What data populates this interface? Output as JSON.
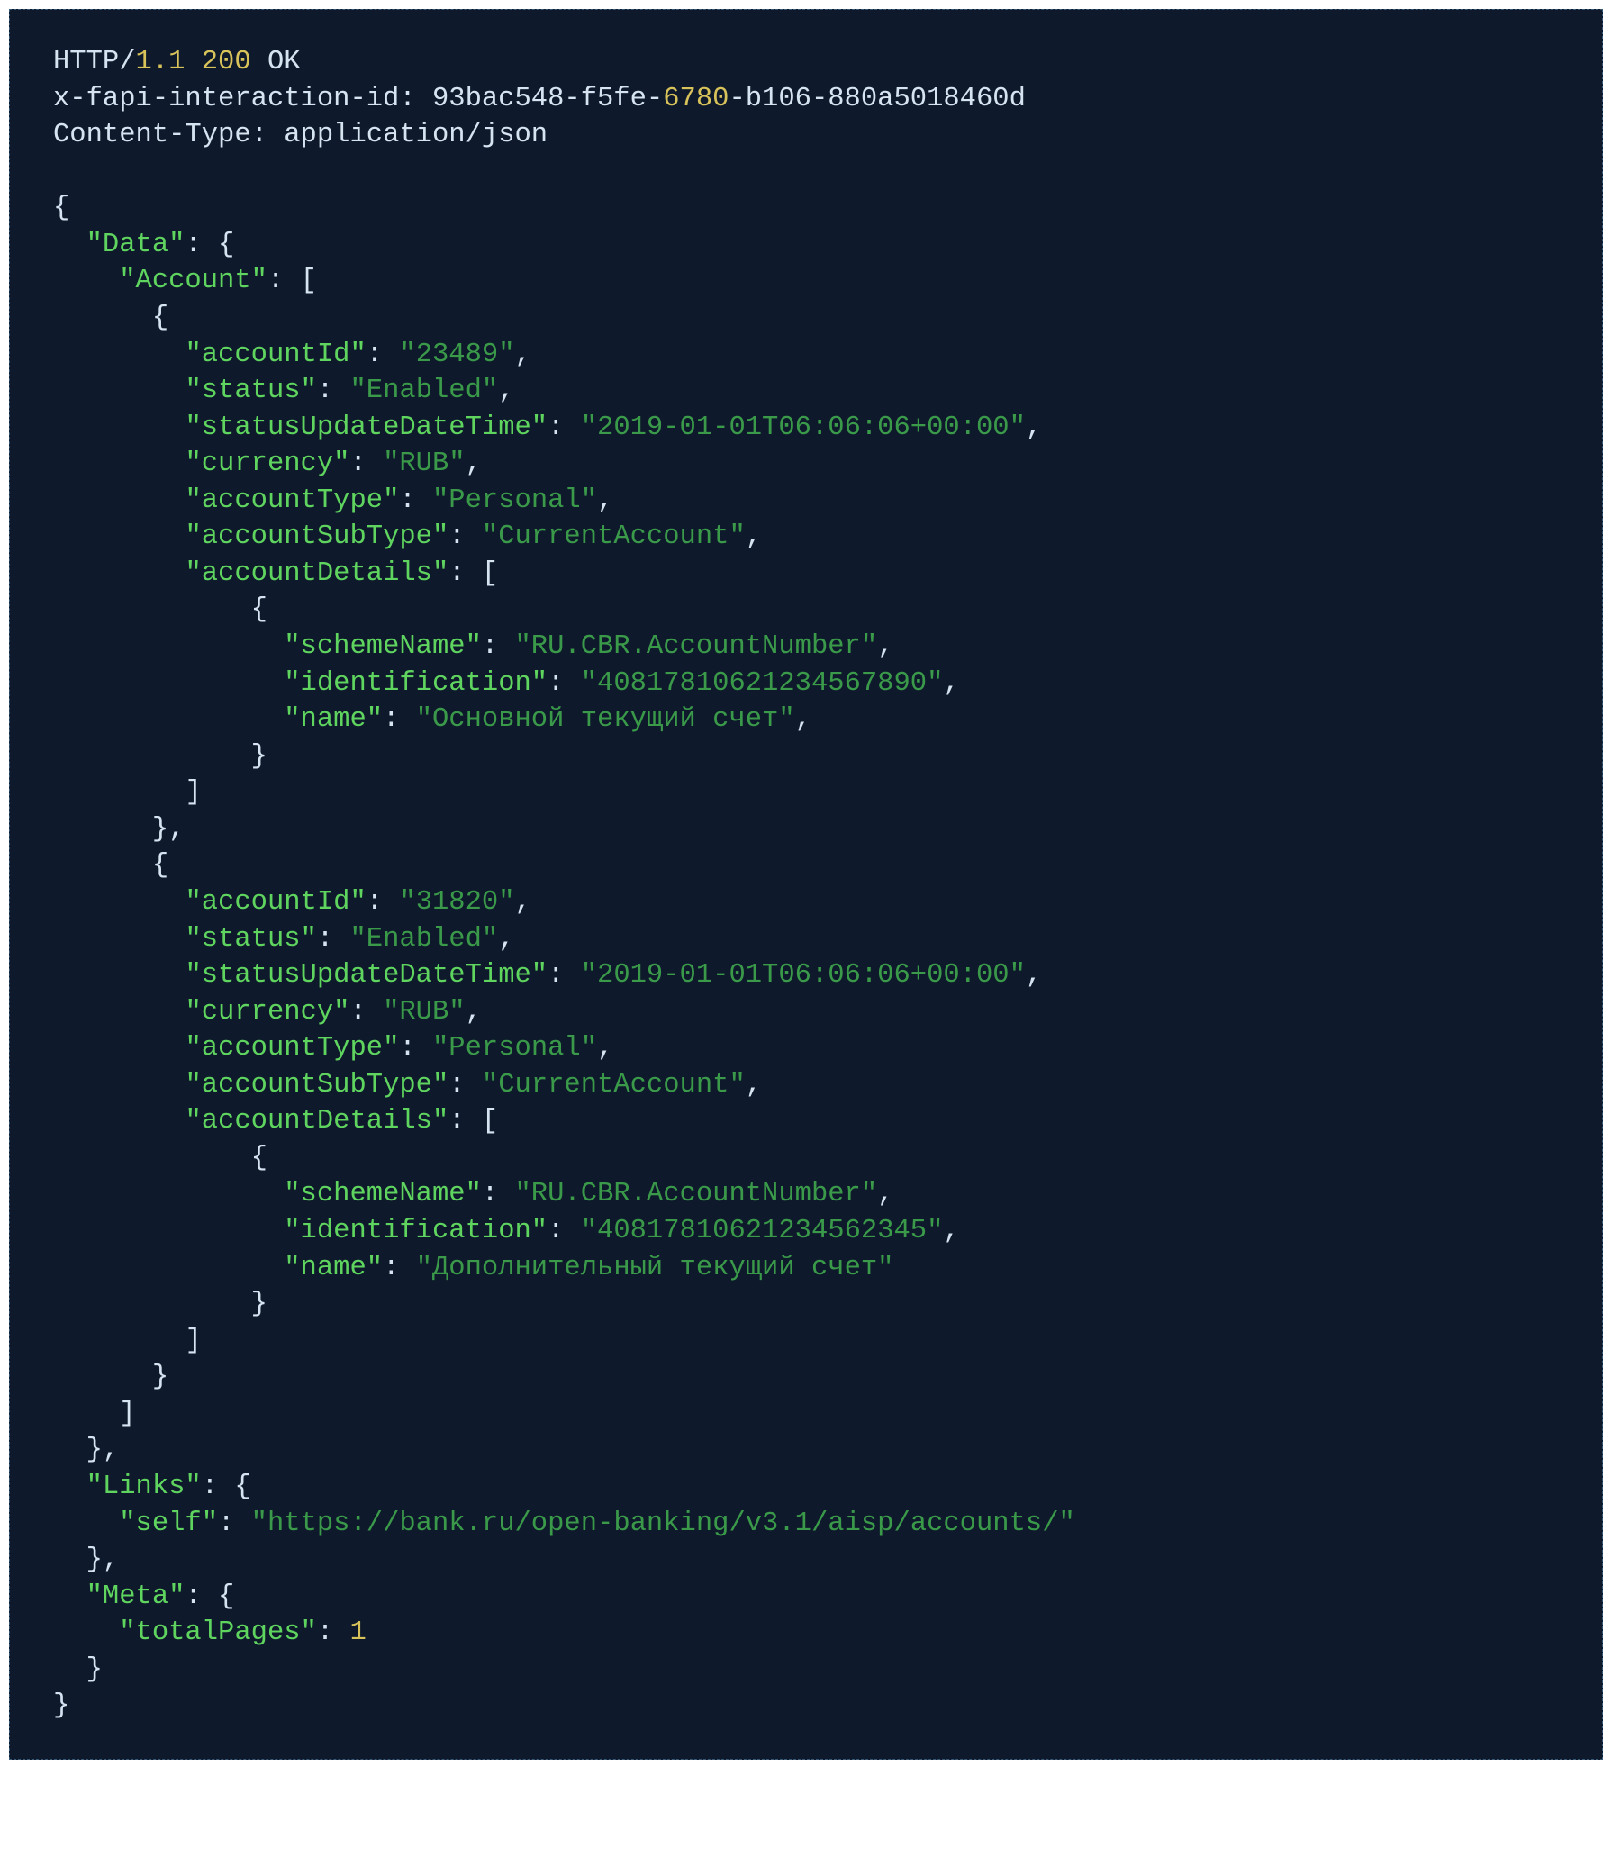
{
  "http": {
    "protocol_prefix": "HTTP/",
    "version": "1.1",
    "status_code": "200",
    "status_text": "OK",
    "headers": {
      "x_fapi_label": "x-fapi-interaction-id: ",
      "x_fapi_pre": "93bac548-f5fe-",
      "x_fapi_mid": "6780",
      "x_fapi_post": "-b106-880a5018460d",
      "content_type_label": "Content-Type: ",
      "content_type_value": "application/json"
    }
  },
  "body": {
    "Data_key": "\"Data\"",
    "Account_key": "\"Account\"",
    "accounts": [
      {
        "accountId_key": "\"accountId\"",
        "accountId_val": "\"23489\"",
        "status_key": "\"status\"",
        "status_val": "\"Enabled\"",
        "statusUDT_key": "\"statusUpdateDateTime\"",
        "statusUDT_val": "\"2019-01-01T06:06:06+00:00\"",
        "currency_key": "\"currency\"",
        "currency_val": "\"RUB\"",
        "accountType_key": "\"accountType\"",
        "accountType_val": "\"Personal\"",
        "accountSubType_key": "\"accountSubType\"",
        "accountSubType_val": "\"CurrentAccount\"",
        "accountDetails_key": "\"accountDetails\"",
        "details": {
          "schemeName_key": "\"schemeName\"",
          "schemeName_val": "\"RU.CBR.AccountNumber\"",
          "identification_key": "\"identification\"",
          "identification_val": "\"40817810621234567890\"",
          "name_key": "\"name\"",
          "name_val": "\"Основной текущий счет\""
        }
      },
      {
        "accountId_key": "\"accountId\"",
        "accountId_val": "\"31820\"",
        "status_key": "\"status\"",
        "status_val": "\"Enabled\"",
        "statusUDT_key": "\"statusUpdateDateTime\"",
        "statusUDT_val": "\"2019-01-01T06:06:06+00:00\"",
        "currency_key": "\"currency\"",
        "currency_val": "\"RUB\"",
        "accountType_key": "\"accountType\"",
        "accountType_val": "\"Personal\"",
        "accountSubType_key": "\"accountSubType\"",
        "accountSubType_val": "\"CurrentAccount\"",
        "accountDetails_key": "\"accountDetails\"",
        "details": {
          "schemeName_key": "\"schemeName\"",
          "schemeName_val": "\"RU.CBR.AccountNumber\"",
          "identification_key": "\"identification\"",
          "identification_val": "\"40817810621234562345\"",
          "name_key": "\"name\"",
          "name_val": "\"Дополнительный текущий счет\""
        }
      }
    ],
    "Links_key": "\"Links\"",
    "self_key": "\"self\"",
    "self_val": "\"https://bank.ru/open-banking/v3.1/aisp/accounts/\"",
    "Meta_key": "\"Meta\"",
    "totalPages_key": "\"totalPages\"",
    "totalPages_val": "1"
  },
  "punct": {
    "open_brace": "{",
    "close_brace": "}",
    "open_bracket": "[",
    "close_bracket": "]",
    "colon_sp": ": ",
    "comma": ",",
    "sp": " "
  }
}
